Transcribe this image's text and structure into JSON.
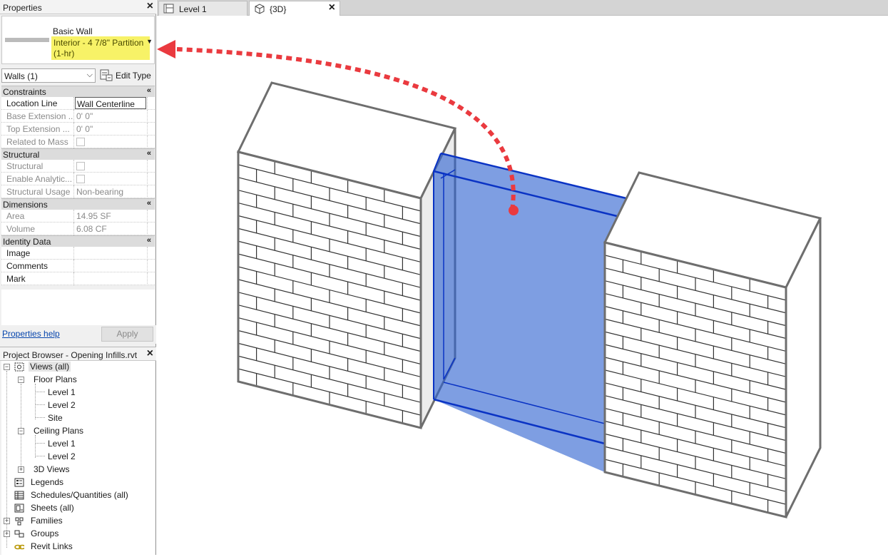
{
  "properties": {
    "title": "Properties",
    "type_family": "Basic Wall",
    "type_name": "Interior - 4 7/8\" Partition (1-hr)",
    "selector_value": "Walls (1)",
    "edit_type_label": "Edit Type",
    "groups": {
      "constraints": {
        "label": "Constraints",
        "rows": [
          {
            "name": "Location Line",
            "value": "Wall Centerline"
          },
          {
            "name": "Base Extension ...",
            "value": "0'  0\""
          },
          {
            "name": "Top Extension ...",
            "value": "0'  0\""
          },
          {
            "name": "Related to Mass",
            "value": ""
          }
        ]
      },
      "structural": {
        "label": "Structural",
        "rows": [
          {
            "name": "Structural",
            "value": ""
          },
          {
            "name": "Enable Analytic...",
            "value": ""
          },
          {
            "name": "Structural Usage",
            "value": "Non-bearing"
          }
        ]
      },
      "dimensions": {
        "label": "Dimensions",
        "rows": [
          {
            "name": "Area",
            "value": "14.95 SF"
          },
          {
            "name": "Volume",
            "value": "6.08 CF"
          }
        ]
      },
      "identity": {
        "label": "Identity Data",
        "rows": [
          {
            "name": "Image",
            "value": ""
          },
          {
            "name": "Comments",
            "value": ""
          },
          {
            "name": "Mark",
            "value": ""
          }
        ]
      }
    },
    "help_link": "Properties help",
    "apply_label": "Apply"
  },
  "project_browser": {
    "title": "Project Browser - Opening Infills.rvt",
    "views_all": "Views (all)",
    "floor_plans": "Floor Plans",
    "fp_level1": "Level 1",
    "fp_level2": "Level 2",
    "fp_site": "Site",
    "ceiling_plans": "Ceiling Plans",
    "cp_level1": "Level 1",
    "cp_level2": "Level 2",
    "views_3d": "3D Views",
    "legends": "Legends",
    "schedules": "Schedules/Quantities (all)",
    "sheets": "Sheets (all)",
    "families": "Families",
    "groups": "Groups",
    "revit_links": "Revit Links"
  },
  "tabs": [
    {
      "label": "Level 1",
      "active": false
    },
    {
      "label": "{3D}",
      "active": true
    }
  ],
  "colors": {
    "highlight": "#f7f267",
    "selection_fill": "#2f63d0",
    "selection_edge": "#0a33c4",
    "annotation_red": "#ea3a3f"
  }
}
